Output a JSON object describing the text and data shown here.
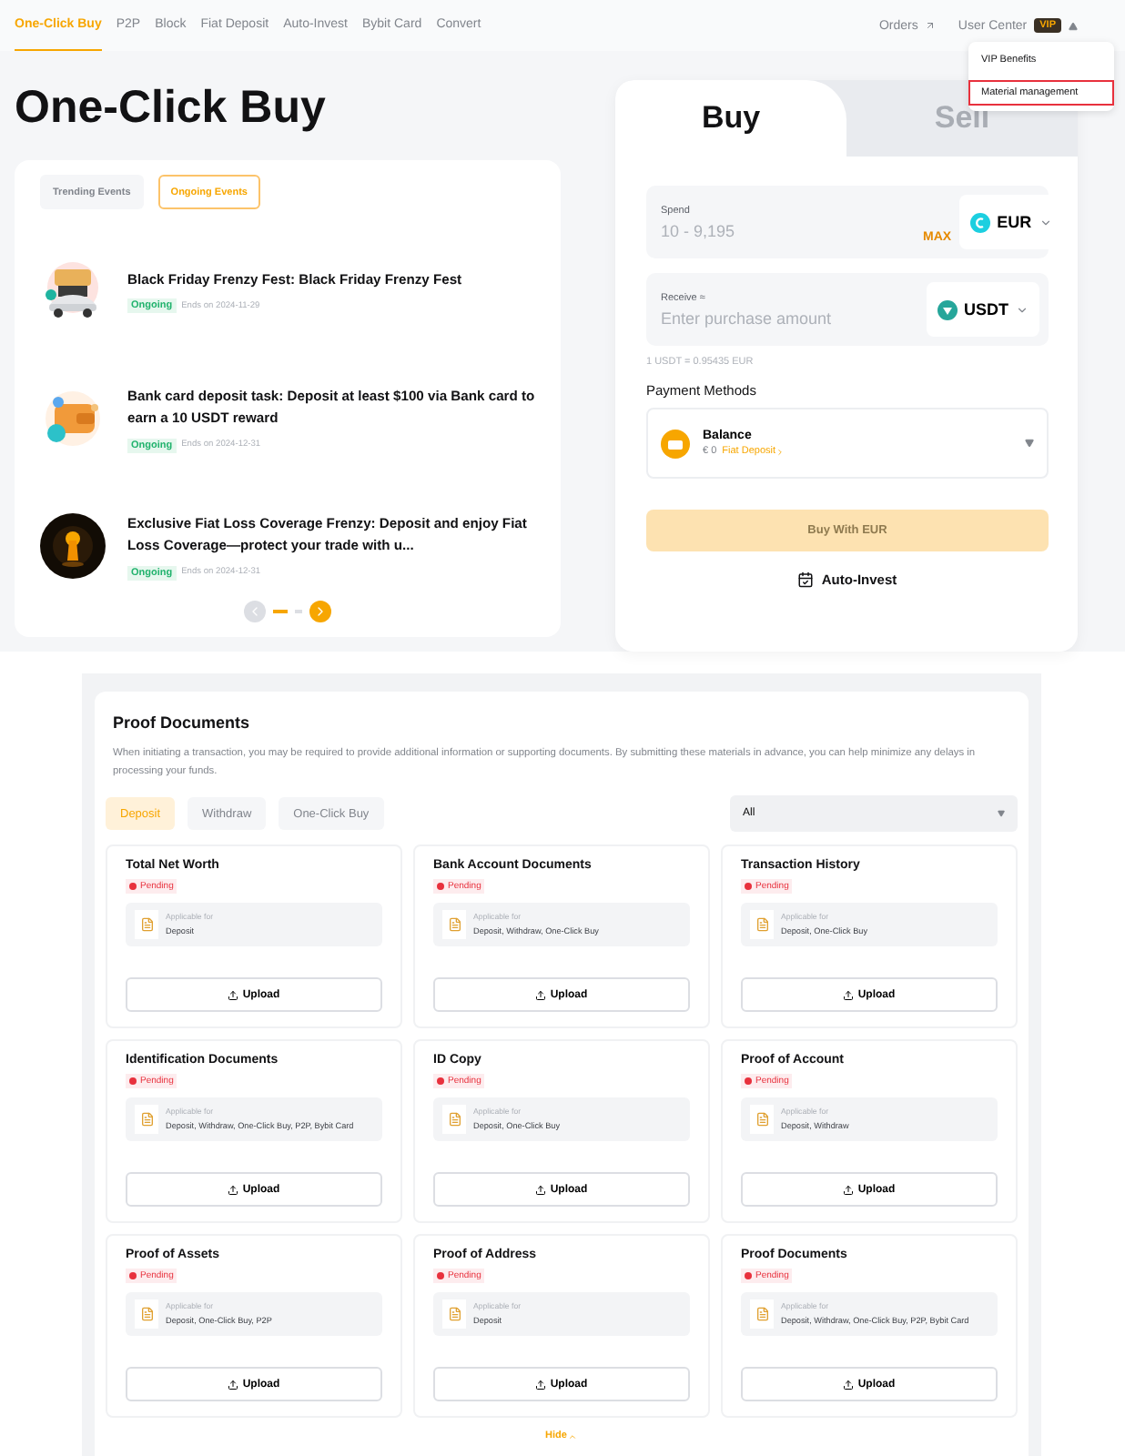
{
  "nav": {
    "items": [
      {
        "label": "One-Click Buy",
        "selected": true
      },
      {
        "label": "P2P",
        "selected": false
      },
      {
        "label": "Block",
        "selected": false
      },
      {
        "label": "Fiat Deposit",
        "selected": false
      },
      {
        "label": "Auto-Invest",
        "selected": false
      },
      {
        "label": "Bybit Card",
        "selected": false
      },
      {
        "label": "Convert",
        "selected": false
      }
    ],
    "orders": "Orders",
    "user_center": "User Center",
    "vip_badge": "VIP"
  },
  "user_menu": {
    "items": [
      {
        "label": "VIP Benefits",
        "highlighted": false
      },
      {
        "label": "Material management",
        "highlighted": true
      }
    ]
  },
  "page_title": "One-Click Buy",
  "events": {
    "tabs": [
      {
        "label": "Trending Events",
        "selected": false
      },
      {
        "label": "Ongoing Events",
        "selected": true
      }
    ],
    "items": [
      {
        "title": "Black Friday Frenzy Fest: Black Friday Frenzy Fest",
        "status": "Ongoing",
        "ends": "Ends on 2024-11-29",
        "kind": "car"
      },
      {
        "title": "Bank card deposit task: Deposit at least $100 via Bank card to earn a 10 USDT reward",
        "status": "Ongoing",
        "ends": "Ends on 2024-12-31",
        "kind": "wallet"
      },
      {
        "title": "Exclusive Fiat Loss Coverage Frenzy: Deposit and enjoy Fiat Loss Coverage—protect your trade with u...",
        "status": "Ongoing",
        "ends": "Ends on 2024-12-31",
        "kind": "keyhole"
      }
    ]
  },
  "trade": {
    "tabs": [
      {
        "label": "Buy",
        "selected": true
      },
      {
        "label": "Sell",
        "selected": false
      }
    ],
    "spend": {
      "label": "Spend",
      "placeholder": "10 - 9,195",
      "max": "MAX",
      "currency": "EUR"
    },
    "receive": {
      "label": "Receive ≈",
      "placeholder": "Enter purchase amount",
      "currency": "USDT"
    },
    "rate": "1 USDT = 0.95435 EUR",
    "payment_label": "Payment Methods",
    "payment": {
      "name": "Balance",
      "amount": "€ 0",
      "link": "Fiat Deposit"
    },
    "button": "Buy With EUR",
    "button_disabled": true,
    "auto_invest": "Auto-Invest"
  },
  "proof": {
    "title": "Proof Documents",
    "description": "When initiating a transaction, you may be required to provide additional information or supporting documents. By submitting these materials in advance, you can help minimize any delays in processing your funds.",
    "tabs": [
      {
        "label": "Deposit",
        "selected": true
      },
      {
        "label": "Withdraw",
        "selected": false
      },
      {
        "label": "One-Click Buy",
        "selected": false
      }
    ],
    "filter": "All",
    "documents": [
      {
        "title": "Total Net Worth",
        "status": "Pending",
        "applicable_label": "Applicable for",
        "applicable": "Deposit",
        "button": "Upload"
      },
      {
        "title": "Bank Account Documents",
        "status": "Pending",
        "applicable_label": "Applicable for",
        "applicable": "Deposit, Withdraw, One-Click Buy",
        "button": "Upload"
      },
      {
        "title": "Transaction History",
        "status": "Pending",
        "applicable_label": "Applicable for",
        "applicable": "Deposit, One-Click Buy",
        "button": "Upload"
      },
      {
        "title": "Identification Documents",
        "status": "Pending",
        "applicable_label": "Applicable for",
        "applicable": "Deposit, Withdraw, One-Click Buy, P2P, Bybit Card",
        "button": "Upload"
      },
      {
        "title": "ID Copy",
        "status": "Pending",
        "applicable_label": "Applicable for",
        "applicable": "Deposit, One-Click Buy",
        "button": "Upload"
      },
      {
        "title": "Proof of Account",
        "status": "Pending",
        "applicable_label": "Applicable for",
        "applicable": "Deposit, Withdraw",
        "button": "Upload"
      },
      {
        "title": "Proof of Assets",
        "status": "Pending",
        "applicable_label": "Applicable for",
        "applicable": "Deposit, One-Click Buy, P2P",
        "button": "Upload"
      },
      {
        "title": "Proof of Address",
        "status": "Pending",
        "applicable_label": "Applicable for",
        "applicable": "Deposit",
        "button": "Upload"
      },
      {
        "title": "Proof Documents",
        "status": "Pending",
        "applicable_label": "Applicable for",
        "applicable": "Deposit, Withdraw, One-Click Buy, P2P, Bybit Card",
        "button": "Upload"
      }
    ],
    "hide": "Hide"
  }
}
